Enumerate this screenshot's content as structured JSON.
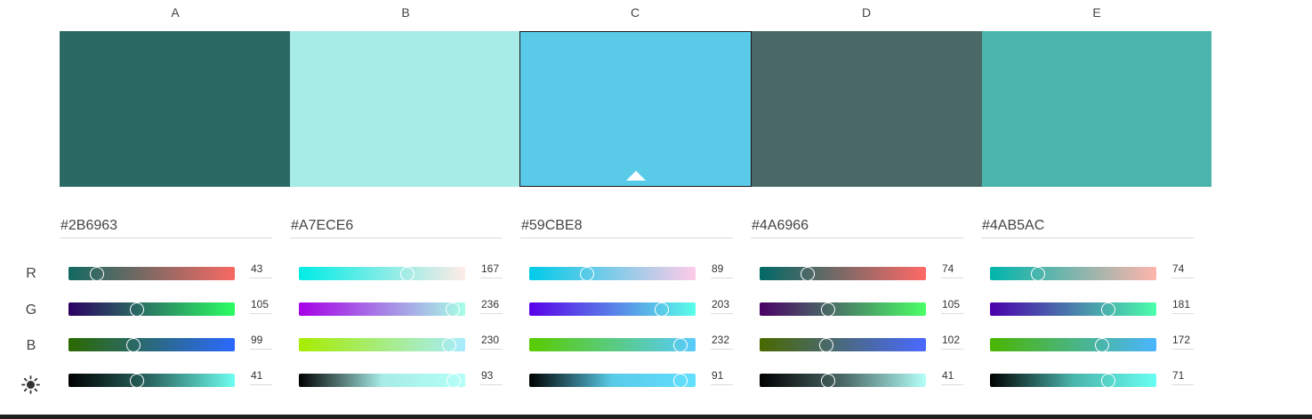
{
  "columns": [
    {
      "label": "A",
      "hex": "#2B6963",
      "swatch_color": "#2B6963",
      "selected": false,
      "channels": {
        "r": {
          "value": "43",
          "fraction": 0.169,
          "gradient": [
            "#136963",
            "#F86963"
          ]
        },
        "g": {
          "value": "105",
          "fraction": 0.412,
          "gradient": [
            "#2B0063",
            "#2BFF63"
          ]
        },
        "b": {
          "value": "99",
          "fraction": 0.388,
          "gradient": [
            "#2B6900",
            "#2B69FF"
          ]
        },
        "brightness": {
          "value": "41",
          "fraction": 0.41,
          "gradient": [
            "#000000",
            "#2B6963",
            "#6EFFF0"
          ]
        }
      }
    },
    {
      "label": "B",
      "hex": "#A7ECE6",
      "swatch_color": "#A7ECE6",
      "selected": false,
      "channels": {
        "r": {
          "value": "167",
          "fraction": 0.655,
          "gradient": [
            "#00ECE6",
            "#FFECE6"
          ]
        },
        "g": {
          "value": "236",
          "fraction": 0.925,
          "gradient": [
            "#A700E6",
            "#A7FFE6"
          ]
        },
        "b": {
          "value": "230",
          "fraction": 0.902,
          "gradient": [
            "#A7EC00",
            "#A7ECFF"
          ]
        },
        "brightness": {
          "value": "93",
          "fraction": 0.93,
          "gradient": [
            "#000000",
            "#A7ECE6",
            "#B4FFF8"
          ]
        }
      }
    },
    {
      "label": "C",
      "hex": "#59CBE8",
      "swatch_color": "#59CBE8",
      "selected": true,
      "channels": {
        "r": {
          "value": "89",
          "fraction": 0.349,
          "gradient": [
            "#00CBE8",
            "#FFCBE8"
          ]
        },
        "g": {
          "value": "203",
          "fraction": 0.796,
          "gradient": [
            "#5900E8",
            "#59FFE8"
          ]
        },
        "b": {
          "value": "232",
          "fraction": 0.91,
          "gradient": [
            "#59CB00",
            "#59CBFF"
          ]
        },
        "brightness": {
          "value": "91",
          "fraction": 0.91,
          "gradient": [
            "#000000",
            "#59CBE8",
            "#62DFFF"
          ]
        }
      }
    },
    {
      "label": "D",
      "hex": "#4A6966",
      "swatch_color": "#4A6966",
      "selected": false,
      "channels": {
        "r": {
          "value": "74",
          "fraction": 0.29,
          "gradient": [
            "#006966",
            "#FF6966"
          ]
        },
        "g": {
          "value": "105",
          "fraction": 0.412,
          "gradient": [
            "#4A0066",
            "#4AFF66"
          ]
        },
        "b": {
          "value": "102",
          "fraction": 0.4,
          "gradient": [
            "#4A6900",
            "#4A69FF"
          ]
        },
        "brightness": {
          "value": "41",
          "fraction": 0.41,
          "gradient": [
            "#000000",
            "#4A6966",
            "#B4FFF8"
          ]
        }
      }
    },
    {
      "label": "E",
      "hex": "#4AB5AC",
      "swatch_color": "#4AB5AC",
      "selected": false,
      "channels": {
        "r": {
          "value": "74",
          "fraction": 0.29,
          "gradient": [
            "#00B5AC",
            "#FFB5AC"
          ]
        },
        "g": {
          "value": "181",
          "fraction": 0.71,
          "gradient": [
            "#4A00AC",
            "#4AFFAC"
          ]
        },
        "b": {
          "value": "172",
          "fraction": 0.675,
          "gradient": [
            "#4AB500",
            "#4AB5FF"
          ]
        },
        "brightness": {
          "value": "71",
          "fraction": 0.71,
          "gradient": [
            "#000000",
            "#4AB5AC",
            "#68FFF2"
          ]
        }
      }
    }
  ],
  "row_labels": {
    "r": "R",
    "g": "G",
    "b": "B",
    "brightness_icon": "sun-icon"
  }
}
